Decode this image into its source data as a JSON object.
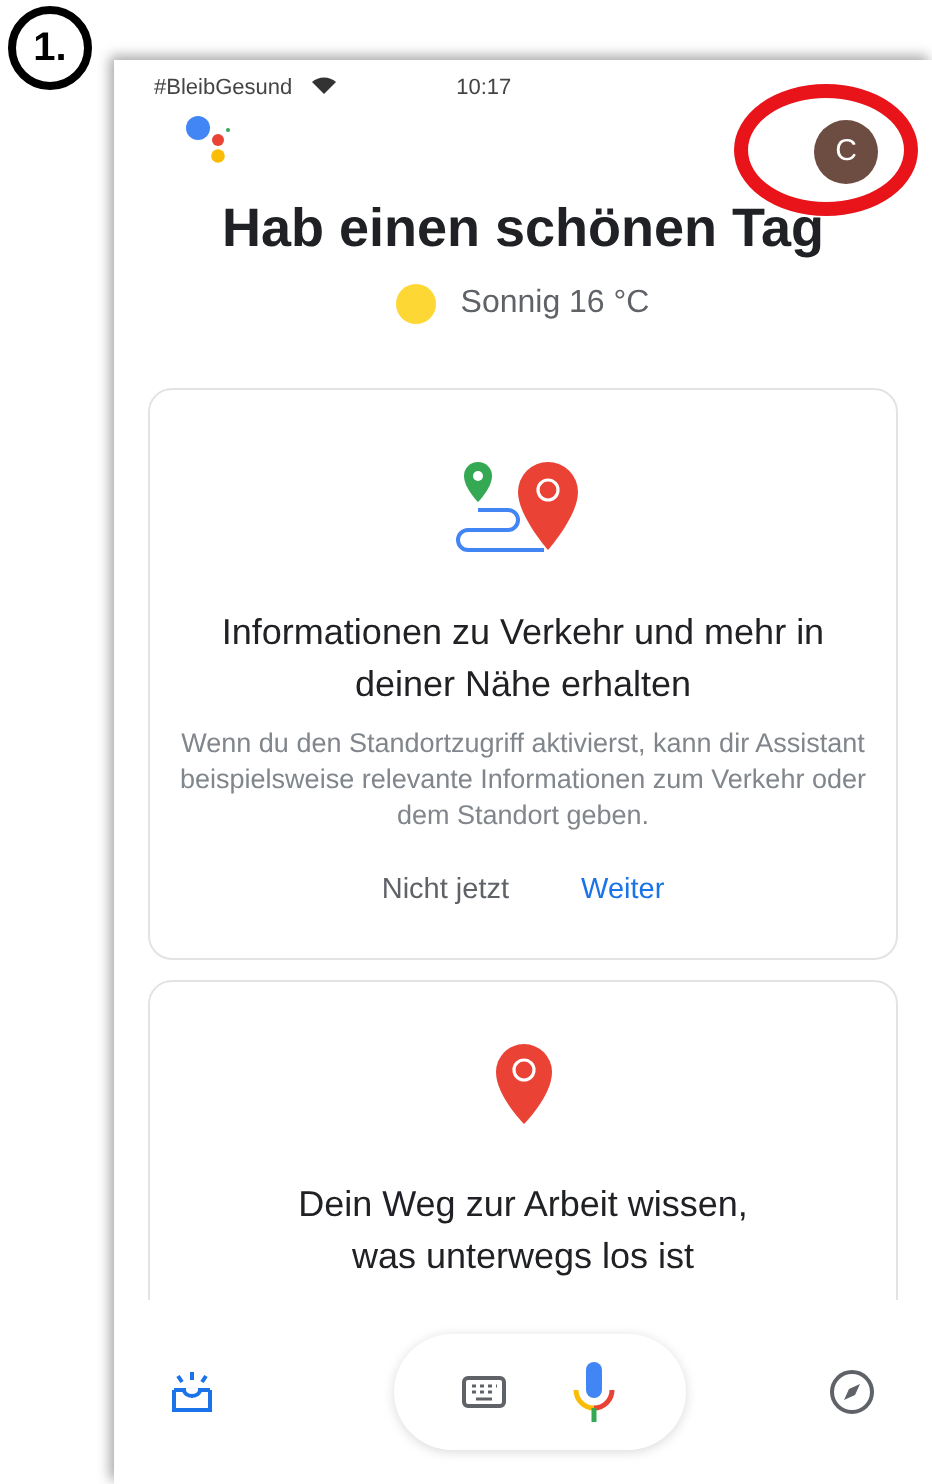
{
  "annotation": {
    "step_label": "1."
  },
  "status_bar": {
    "carrier": "#BleibGesund",
    "time": "10:17"
  },
  "header": {
    "avatar_letter": "C",
    "avatar_highlighted": true
  },
  "greeting": "Hab einen schönen Tag",
  "weather": {
    "text": "Sonnig 16 °C"
  },
  "cards": [
    {
      "kind": "route",
      "title": "Informationen zu Verkehr und mehr in deiner Nähe erhalten",
      "body": "Wenn du den Standortzugriff aktivierst, kann dir Assistant beispielsweise relevante Informationen zum Verkehr oder dem Standort geben.",
      "actions": [
        "Nicht jetzt",
        "Weiter"
      ]
    },
    {
      "kind": "pin",
      "title": "Dein Weg zur Arbeit wissen, was unterwegs los ist"
    }
  ]
}
